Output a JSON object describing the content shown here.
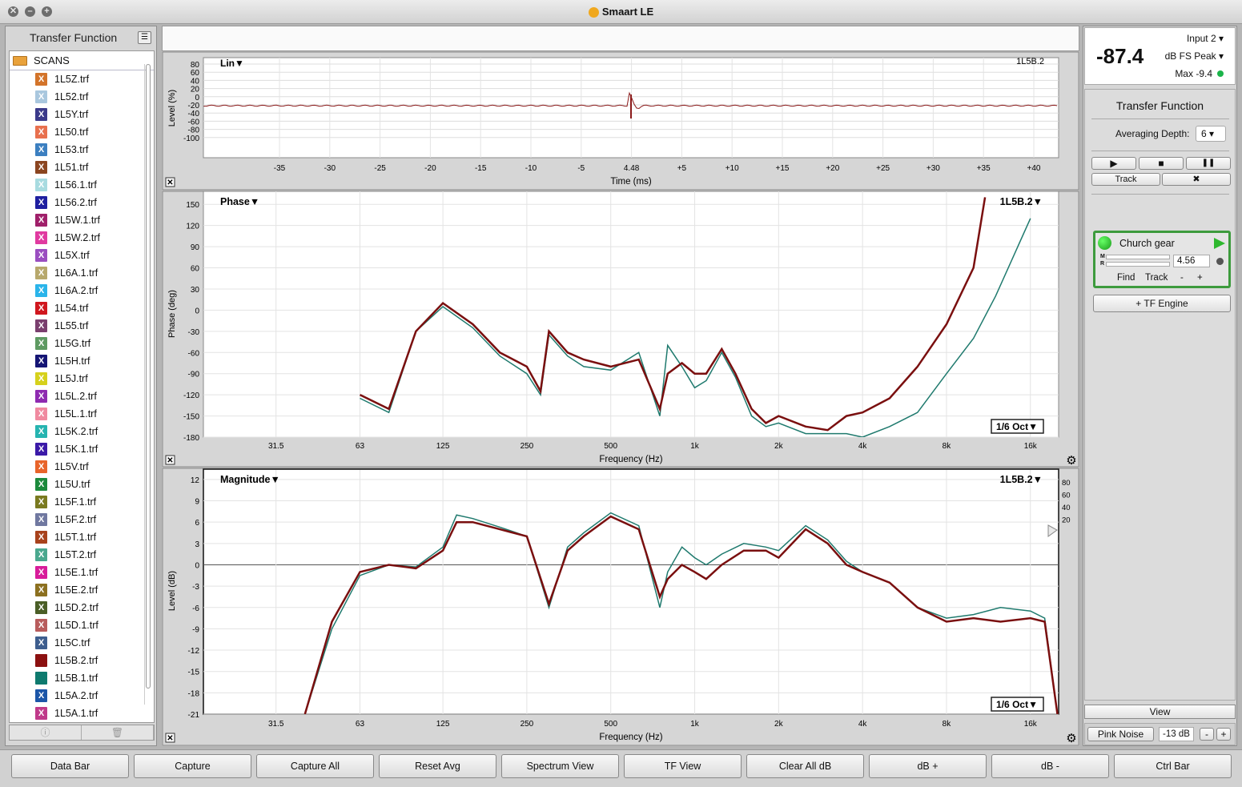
{
  "window": {
    "title": "Smaart LE"
  },
  "left": {
    "title": "Transfer Function",
    "folder": "SCANS",
    "files": [
      {
        "name": "1L5Z.trf",
        "color": "#d3742a"
      },
      {
        "name": "1L52.trf",
        "color": "#a9c7de"
      },
      {
        "name": "1L5Y.trf",
        "color": "#3b3a8a"
      },
      {
        "name": "1L50.trf",
        "color": "#e8704e"
      },
      {
        "name": "1L53.trf",
        "color": "#3c7fc0"
      },
      {
        "name": "1L51.trf",
        "color": "#8b4520"
      },
      {
        "name": "1L56.1.trf",
        "color": "#a8dbe0"
      },
      {
        "name": "1L56.2.trf",
        "color": "#1f1fa0"
      },
      {
        "name": "1L5W.1.trf",
        "color": "#a0206a"
      },
      {
        "name": "1L5W.2.trf",
        "color": "#e03aa0"
      },
      {
        "name": "1L5X.trf",
        "color": "#9a4ec0"
      },
      {
        "name": "1L6A.1.trf",
        "color": "#b7a86c"
      },
      {
        "name": "1L6A.2.trf",
        "color": "#2ab4ea"
      },
      {
        "name": "1L54.trf",
        "color": "#d0171e"
      },
      {
        "name": "1L55.trf",
        "color": "#7a3f6e"
      },
      {
        "name": "1L5G.trf",
        "color": "#5e9a62"
      },
      {
        "name": "1L5H.trf",
        "color": "#151574"
      },
      {
        "name": "1L5J.trf",
        "color": "#d6d11c"
      },
      {
        "name": "1L5L.2.trf",
        "color": "#8e2ab0"
      },
      {
        "name": "1L5L.1.trf",
        "color": "#f08aa0"
      },
      {
        "name": "1L5K.2.trf",
        "color": "#26b4b0"
      },
      {
        "name": "1L5K.1.trf",
        "color": "#3b1aa8"
      },
      {
        "name": "1L5V.trf",
        "color": "#e8642a"
      },
      {
        "name": "1L5U.trf",
        "color": "#1c8a3c"
      },
      {
        "name": "1L5F.1.trf",
        "color": "#7a7a20"
      },
      {
        "name": "1L5F.2.trf",
        "color": "#7078a0"
      },
      {
        "name": "1L5T.1.trf",
        "color": "#a8421c"
      },
      {
        "name": "1L5T.2.trf",
        "color": "#4aa88e"
      },
      {
        "name": "1L5E.1.trf",
        "color": "#d81c9a"
      },
      {
        "name": "1L5E.2.trf",
        "color": "#8c7020"
      },
      {
        "name": "1L5D.2.trf",
        "color": "#4a5e26"
      },
      {
        "name": "1L5D.1.trf",
        "color": "#b85c5c"
      },
      {
        "name": "1L5C.trf",
        "color": "#3e5e8e"
      },
      {
        "name": "1L5B.2.trf",
        "color": "#8b1010"
      },
      {
        "name": "1L5B.1.trf",
        "color": "#0e7a6e"
      },
      {
        "name": "1L5A.2.trf",
        "color": "#1c56a8"
      },
      {
        "name": "1L5A.1.trf",
        "color": "#c03a8a"
      }
    ]
  },
  "plots": {
    "impulse": {
      "label": "Lin▼",
      "trace": "1L5B.2",
      "ylabel": "Level (%)",
      "xlabel": "Time (ms)",
      "yticks": [
        "80",
        "60",
        "40",
        "20",
        "0",
        "-20",
        "-40",
        "-60",
        "-80",
        "-100"
      ],
      "xticks": [
        "-35",
        "-30",
        "-25",
        "-20",
        "-15",
        "-10",
        "-5",
        "4.48",
        "+5",
        "+10",
        "+15",
        "+20",
        "+25",
        "+30",
        "+35",
        "+40"
      ]
    },
    "phase": {
      "label": "Phase▼",
      "trace": "1L5B.2▼",
      "ylabel": "Phase (deg)",
      "xlabel": "Frequency (Hz)",
      "smoothing": "1/6 Oct▼",
      "yticks": [
        "150",
        "120",
        "90",
        "60",
        "30",
        "0",
        "-30",
        "-60",
        "-90",
        "-120",
        "-150",
        "-180"
      ],
      "xticks": [
        "31.5",
        "63",
        "125",
        "250",
        "500",
        "1k",
        "2k",
        "4k",
        "8k",
        "16k"
      ]
    },
    "magnitude": {
      "label": "Magnitude▼",
      "trace": "1L5B.2▼",
      "ylabel": "Level (dB)",
      "xlabel": "Frequency (Hz)",
      "smoothing": "1/6 Oct▼",
      "yticks": [
        "12",
        "9",
        "6",
        "3",
        "0",
        "-3",
        "-6",
        "-9",
        "-12",
        "-15",
        "-18",
        "-21"
      ],
      "coh_ticks": [
        "80",
        "60",
        "40",
        "20"
      ],
      "xticks": [
        "31.5",
        "63",
        "125",
        "250",
        "500",
        "1k",
        "2k",
        "4k",
        "8k",
        "16k"
      ]
    }
  },
  "chart_data": [
    {
      "type": "line",
      "title": "Phase",
      "xlabel": "Frequency (Hz)",
      "ylabel": "Phase (deg)",
      "ylim": [
        -180,
        165
      ],
      "xscale": "log",
      "series": [
        {
          "name": "1L5B.2",
          "color": "#7a0f0f",
          "x": [
            63,
            80,
            100,
            125,
            160,
            200,
            250,
            280,
            300,
            350,
            400,
            500,
            630,
            750,
            800,
            900,
            1000,
            1100,
            1250,
            1400,
            1600,
            1800,
            2000,
            2500,
            3000,
            3500,
            4000,
            5000,
            6300,
            8000,
            10000,
            11000
          ],
          "y": [
            -120,
            -140,
            -30,
            10,
            -20,
            -60,
            -80,
            -115,
            -30,
            -60,
            -70,
            -80,
            -70,
            -140,
            -90,
            -75,
            -90,
            -90,
            -55,
            -90,
            -140,
            -160,
            -150,
            -165,
            -170,
            -150,
            -145,
            -125,
            -80,
            -20,
            60,
            160
          ]
        },
        {
          "name": "1L5B.1",
          "color": "#1f7a6e",
          "x": [
            63,
            80,
            100,
            125,
            160,
            200,
            250,
            280,
            300,
            350,
            400,
            500,
            630,
            750,
            800,
            900,
            1000,
            1100,
            1250,
            1400,
            1600,
            1800,
            2000,
            2500,
            3000,
            3500,
            4000,
            5000,
            6300,
            8000,
            10000,
            12000,
            16000
          ],
          "y": [
            -125,
            -145,
            -30,
            5,
            -25,
            -65,
            -90,
            -120,
            -35,
            -65,
            -80,
            -85,
            -60,
            -150,
            -50,
            -80,
            -110,
            -100,
            -60,
            -95,
            -150,
            -165,
            -160,
            -175,
            -175,
            -175,
            -180,
            -165,
            -145,
            -90,
            -40,
            20,
            130
          ]
        }
      ]
    },
    {
      "type": "line",
      "title": "Magnitude",
      "xlabel": "Frequency (Hz)",
      "ylabel": "Level (dB)",
      "ylim": [
        -21,
        12
      ],
      "xscale": "log",
      "series": [
        {
          "name": "1L5B.2",
          "color": "#7a0f0f",
          "x": [
            40,
            50,
            63,
            80,
            100,
            125,
            140,
            160,
            200,
            250,
            300,
            350,
            400,
            500,
            630,
            750,
            800,
            900,
            1000,
            1100,
            1250,
            1500,
            1800,
            2000,
            2500,
            3000,
            3500,
            4000,
            5000,
            6300,
            8000,
            10000,
            12500,
            16000,
            18000,
            20000
          ],
          "y": [
            -21,
            -8,
            -1,
            0,
            -0.5,
            2,
            6,
            6,
            5,
            4,
            -5.5,
            2,
            4,
            6.8,
            5,
            -4.5,
            -2,
            0,
            -1,
            -2,
            0,
            2,
            2,
            1,
            5,
            3,
            0,
            -1,
            -2.5,
            -6,
            -8,
            -7.5,
            -8,
            -7.5,
            -8,
            -21
          ]
        },
        {
          "name": "1L5B.1",
          "color": "#1f7a6e",
          "x": [
            40,
            50,
            63,
            80,
            100,
            125,
            140,
            160,
            200,
            250,
            300,
            350,
            400,
            500,
            630,
            750,
            800,
            900,
            1000,
            1100,
            1250,
            1500,
            1800,
            2000,
            2500,
            3000,
            3500,
            4000,
            5000,
            6300,
            8000,
            10000,
            12500,
            16000,
            18000,
            20000
          ],
          "y": [
            -21,
            -9,
            -1.5,
            0,
            -0.3,
            2.5,
            7,
            6.5,
            5.3,
            4,
            -6,
            2.5,
            4.5,
            7.3,
            5.5,
            -6,
            -1,
            2.5,
            1,
            0,
            1.5,
            3,
            2.5,
            2,
            5.5,
            3.5,
            0.5,
            -1,
            -2.5,
            -6,
            -7.5,
            -7,
            -6,
            -6.5,
            -7.5,
            -21
          ]
        }
      ]
    }
  ],
  "meter": {
    "value": "-87.4",
    "input": "Input 2",
    "mode": "dB FS Peak",
    "max": "Max -9.4"
  },
  "right": {
    "title": "Transfer Function",
    "avg_label": "Averaging Depth:",
    "avg_value": "6",
    "play": "▶",
    "stop": "■",
    "pause": "❚❚",
    "track": "Track",
    "tools": "✖",
    "engine": {
      "name": "Church gear",
      "delay": "4.56",
      "find": "Find",
      "track": "Track",
      "minus": "-",
      "plus": "+",
      "m": "M",
      "r": "R"
    },
    "add_engine": "+ TF Engine",
    "view": "View",
    "pink": "Pink Noise",
    "pink_level": "-13 dB",
    "minus": "-",
    "plus": "+"
  },
  "bottom": [
    "Data Bar",
    "Capture",
    "Capture All",
    "Reset Avg",
    "Spectrum View",
    "TF View",
    "Clear All dB",
    "dB +",
    "dB -",
    "Ctrl Bar"
  ]
}
